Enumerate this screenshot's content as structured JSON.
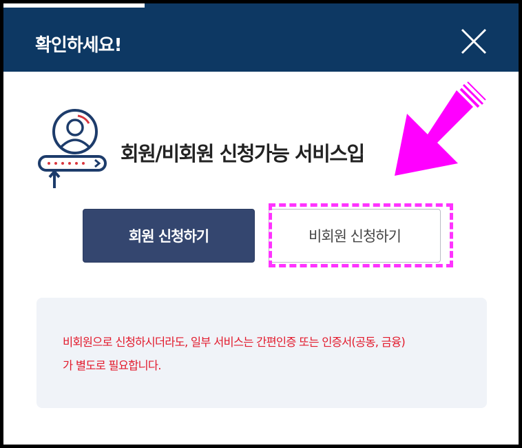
{
  "dialog": {
    "title": "확인하세요!",
    "close_icon": "close-icon"
  },
  "service": {
    "icon": "member-login-icon",
    "text": "회원/비회원 신청가능 서비스입"
  },
  "buttons": {
    "member_label": "회원 신청하기",
    "guest_label": "비회원 신청하기"
  },
  "notice": {
    "line1": "비회원으로 신청하시더라도, 일부 서비스는 간편인증 또는 인증서(공동, 금융)",
    "line2": "가 별도로 필요합니다."
  },
  "colors": {
    "header": "#0d3863",
    "member_button": "#34466f",
    "highlight": "#ff33ff",
    "notice_text": "#e21a2c",
    "notice_bg": "#f0f3f8"
  }
}
